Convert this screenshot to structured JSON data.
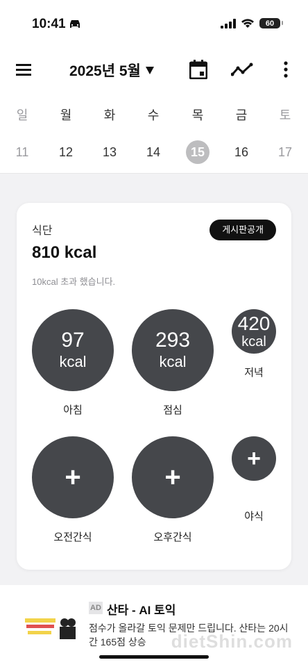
{
  "status": {
    "time": "10:41",
    "battery": "60"
  },
  "header": {
    "month": "2025년 5월"
  },
  "week": [
    {
      "day": "일",
      "date": "11"
    },
    {
      "day": "월",
      "date": "12"
    },
    {
      "day": "화",
      "date": "13"
    },
    {
      "day": "수",
      "date": "14"
    },
    {
      "day": "목",
      "date": "15"
    },
    {
      "day": "금",
      "date": "16"
    },
    {
      "day": "토",
      "date": "17"
    }
  ],
  "card": {
    "label": "식단",
    "total": "810 kcal",
    "note": "10kcal 초과 했습니다.",
    "board_button": "게시판공개"
  },
  "meals": [
    {
      "value": "97",
      "unit": "kcal",
      "label": "아침"
    },
    {
      "value": "293",
      "unit": "kcal",
      "label": "점심"
    },
    {
      "value": "420",
      "unit": "kcal",
      "label": "저녁"
    },
    {
      "value": "+",
      "label": "오전간식"
    },
    {
      "value": "+",
      "label": "오후간식"
    },
    {
      "value": "+",
      "label": "야식"
    }
  ],
  "ad": {
    "badge": "AD",
    "title": "산타 - AI 토익",
    "desc": "점수가 올라갈 토익 문제만 드립니다. 산타는 20시간 165점 상승"
  },
  "watermark": "dietShin.com"
}
